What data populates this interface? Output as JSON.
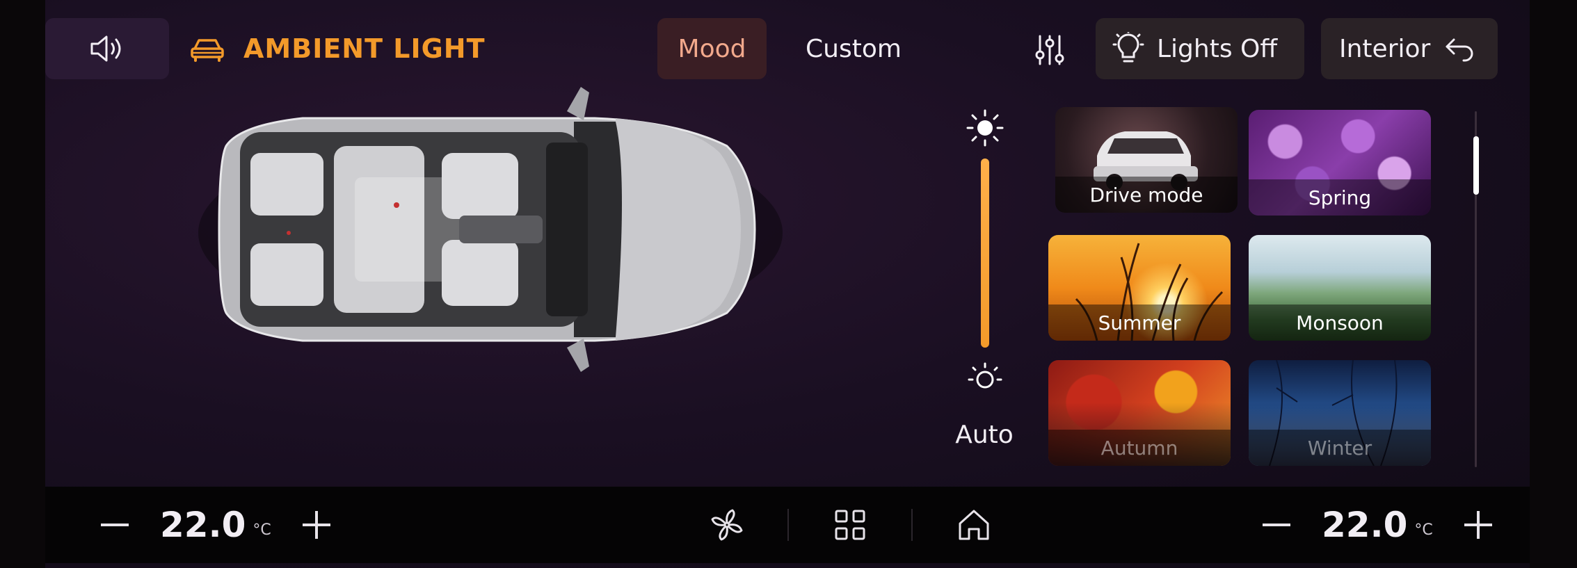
{
  "header": {
    "title": "AMBIENT LIGHT",
    "tabs": [
      {
        "label": "Mood",
        "active": true
      },
      {
        "label": "Custom",
        "active": false
      }
    ],
    "lights_button": "Lights Off",
    "zone_button": "Interior"
  },
  "brightness": {
    "mode_label": "Auto",
    "level": 1.0
  },
  "themes": [
    {
      "label": "Drive mode"
    },
    {
      "label": "Spring"
    },
    {
      "label": "Summer"
    },
    {
      "label": "Monsoon"
    },
    {
      "label": "Autumn"
    },
    {
      "label": "Winter"
    }
  ],
  "climate": {
    "left_temp": "22.0",
    "right_temp": "22.0",
    "unit": "°C"
  },
  "colors": {
    "accent": "#f39a2a",
    "background": "#1a0f22",
    "active_tab": "#3a1e24"
  },
  "icons": {
    "sound": "speaker-icon",
    "car": "car-icon",
    "equalizer": "sliders-icon",
    "bulb": "bulb-icon",
    "back": "back-arrow-icon",
    "sun_high": "sun-bright-icon",
    "sun_low": "sun-dim-icon",
    "fan": "fan-icon",
    "apps": "apps-grid-icon",
    "home": "home-icon"
  }
}
